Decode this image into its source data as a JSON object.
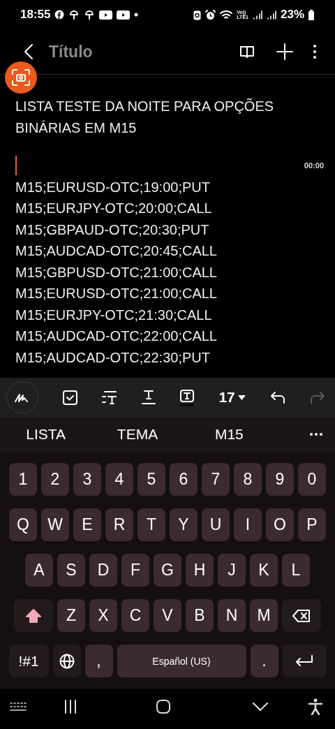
{
  "status_bar": {
    "time": "18:55",
    "network_top": "Vo))",
    "network_bottom": "LTE1",
    "battery": "23%"
  },
  "app_bar": {
    "title": "Título"
  },
  "note": {
    "title": "LISTA TESTE DA NOITE PARA OPÇÕES BINÁRIAS EM M15",
    "recording_time": "00:00",
    "lines": [
      "M15;EURUSD-OTC;19:00;PUT",
      "M15;EURJPY-OTC;20:00;CALL",
      "M15;GBPAUD-OTC;20:30;PUT",
      "M15;AUDCAD-OTC;20:45;CALL",
      "M15;GBPUSD-OTC;21:00;CALL",
      "M15;EURUSD-OTC;21:00;CALL",
      "M15;EURJPY-OTC;21:30;CALL",
      "M15;AUDCAD-OTC;22:00;CALL",
      "M15;AUDCAD-OTC;22:30;PUT"
    ]
  },
  "toolbar": {
    "font_size": "17",
    "redo_disabled": true
  },
  "suggestions": [
    "LISTA",
    "TEMA",
    "M15"
  ],
  "keyboard": {
    "rows": [
      {
        "keys": [
          {
            "kind": "char",
            "label": "1"
          },
          {
            "kind": "char",
            "label": "2"
          },
          {
            "kind": "char",
            "label": "3"
          },
          {
            "kind": "char",
            "label": "4"
          },
          {
            "kind": "char",
            "label": "5"
          },
          {
            "kind": "char",
            "label": "6"
          },
          {
            "kind": "char",
            "label": "7"
          },
          {
            "kind": "char",
            "label": "8"
          },
          {
            "kind": "char",
            "label": "9"
          },
          {
            "kind": "char",
            "label": "0"
          }
        ]
      },
      {
        "keys": [
          {
            "kind": "char",
            "label": "Q"
          },
          {
            "kind": "char",
            "label": "W"
          },
          {
            "kind": "char",
            "label": "E"
          },
          {
            "kind": "char",
            "label": "R"
          },
          {
            "kind": "char",
            "label": "T"
          },
          {
            "kind": "char",
            "label": "Y"
          },
          {
            "kind": "char",
            "label": "U"
          },
          {
            "kind": "char",
            "label": "I"
          },
          {
            "kind": "char",
            "label": "O"
          },
          {
            "kind": "char",
            "label": "P"
          }
        ]
      },
      {
        "keys": [
          {
            "kind": "char",
            "label": "A"
          },
          {
            "kind": "char",
            "label": "S"
          },
          {
            "kind": "char",
            "label": "D"
          },
          {
            "kind": "char",
            "label": "F"
          },
          {
            "kind": "char",
            "label": "G"
          },
          {
            "kind": "char",
            "label": "H"
          },
          {
            "kind": "char",
            "label": "J"
          },
          {
            "kind": "char",
            "label": "K"
          },
          {
            "kind": "char",
            "label": "L"
          }
        ]
      },
      {
        "keys": [
          {
            "kind": "shift"
          },
          {
            "kind": "char",
            "label": "Z"
          },
          {
            "kind": "char",
            "label": "X"
          },
          {
            "kind": "char",
            "label": "C"
          },
          {
            "kind": "char",
            "label": "V"
          },
          {
            "kind": "char",
            "label": "B"
          },
          {
            "kind": "char",
            "label": "N"
          },
          {
            "kind": "char",
            "label": "M"
          },
          {
            "kind": "backspace"
          }
        ]
      },
      {
        "keys": [
          {
            "kind": "symbols",
            "label": "!#1"
          },
          {
            "kind": "globe"
          },
          {
            "kind": "char",
            "label": ","
          },
          {
            "kind": "space",
            "label": "Español (US)"
          },
          {
            "kind": "char",
            "label": "."
          },
          {
            "kind": "enter"
          }
        ]
      }
    ]
  }
}
